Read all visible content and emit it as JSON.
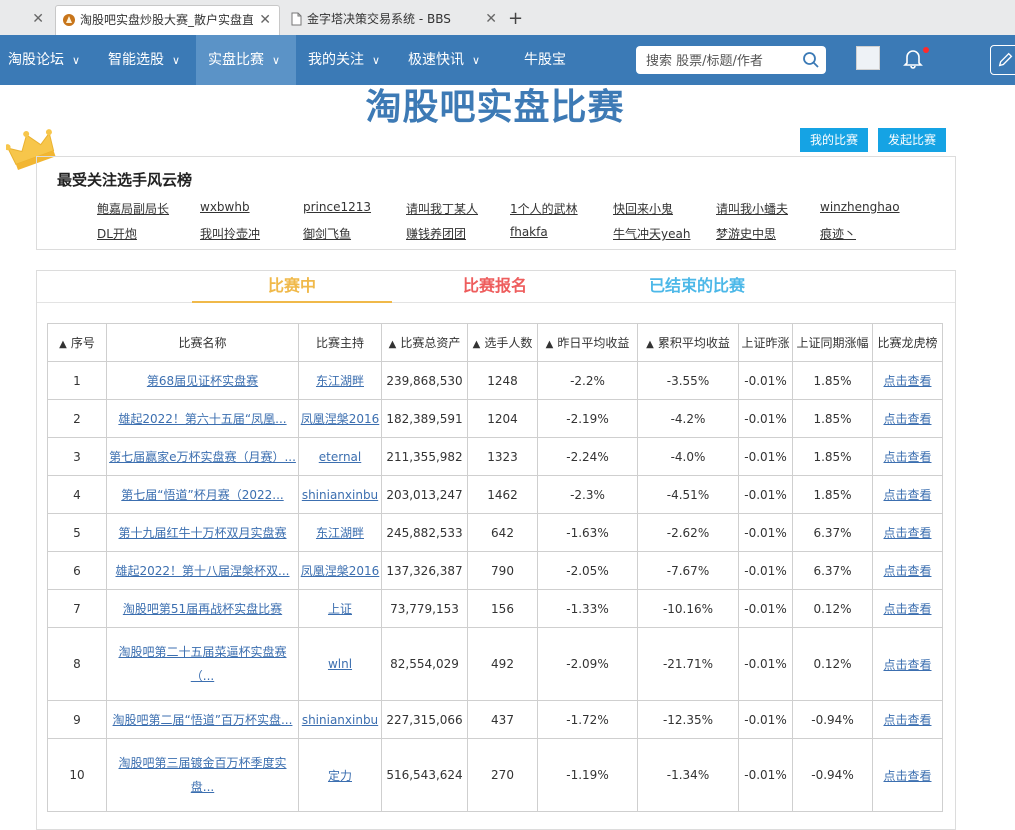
{
  "browser": {
    "tabs": [
      {
        "title": ""
      },
      {
        "title": "淘股吧实盘炒股大赛_散户实盘直"
      },
      {
        "title": "金字塔决策交易系统 - BBS"
      }
    ],
    "close_glyph": "✕",
    "new_tab_glyph": "+"
  },
  "nav": {
    "items": [
      {
        "label": "淘股论坛",
        "dropdown": true
      },
      {
        "label": "智能选股",
        "dropdown": true
      },
      {
        "label": "实盘比赛",
        "dropdown": true,
        "active": true
      },
      {
        "label": "我的关注",
        "dropdown": true
      },
      {
        "label": "极速快讯",
        "dropdown": true
      },
      {
        "label": "牛股宝",
        "dropdown": false
      }
    ],
    "chevron": "∨",
    "search_placeholder": "搜索 股票/标题/作者",
    "accent_color": "#3b7ab6"
  },
  "page": {
    "title": "淘股吧实盘比赛",
    "my_comp_button": "我的比赛",
    "start_comp_button": "发起比赛"
  },
  "fans": {
    "title": "最受关注选手风云榜",
    "users": [
      "鲍嘉局副局长",
      "wxbwhb",
      "prince1213",
      "请叫我丁某人",
      "1个人的武林",
      "快回来小鬼",
      "请叫我小蟠夫",
      "winzhenghao",
      "DL开炮",
      "我叫拎壶冲",
      "御剑飞鱼",
      "赚钱养团团",
      "fhakfa",
      "牛气冲天yeah",
      "梦游史中思",
      "痕迹丶"
    ]
  },
  "tabs": {
    "ongoing": "比赛中",
    "signup": "比赛报名",
    "ended": "已结束的比赛"
  },
  "table": {
    "sort_glyph": "▲",
    "headers": [
      "序号",
      "比赛名称",
      "比赛主持",
      "比赛总资产",
      "选手人数",
      "昨日平均收益",
      "累积平均收益",
      "上证昨涨",
      "上证同期涨幅",
      "比赛龙虎榜"
    ],
    "rows": [
      {
        "no": "1",
        "name": "第68届见证杯实盘赛",
        "host": "东江湖畔",
        "assets": "239,868,530",
        "players": "1248",
        "yday": "-2.2%",
        "cum": "-3.55%",
        "sh": "-0.01%",
        "sh_period": "1.85%",
        "link": "点击查看"
      },
      {
        "no": "2",
        "name": "雄起2022！第六十五届“凤凰...",
        "host": "凤凰涅槃2016",
        "assets": "182,389,591",
        "players": "1204",
        "yday": "-2.19%",
        "cum": "-4.2%",
        "sh": "-0.01%",
        "sh_period": "1.85%",
        "link": "点击查看"
      },
      {
        "no": "3",
        "name": "第七届赢家e万杯实盘赛（月赛）...",
        "host": "eternal",
        "assets": "211,355,982",
        "players": "1323",
        "yday": "-2.24%",
        "cum": "-4.0%",
        "sh": "-0.01%",
        "sh_period": "1.85%",
        "link": "点击查看"
      },
      {
        "no": "4",
        "name": "第七届“悟道”杯月赛（2022...",
        "host": "shinianxinbu",
        "assets": "203,013,247",
        "players": "1462",
        "yday": "-2.3%",
        "cum": "-4.51%",
        "sh": "-0.01%",
        "sh_period": "1.85%",
        "link": "点击查看"
      },
      {
        "no": "5",
        "name": "第十九届红牛十万杯双月实盘赛",
        "host": "东江湖畔",
        "assets": "245,882,533",
        "players": "642",
        "yday": "-1.63%",
        "cum": "-2.62%",
        "sh": "-0.01%",
        "sh_period": "6.37%",
        "link": "点击查看"
      },
      {
        "no": "6",
        "name": "雄起2022！第十八届涅槃杯双...",
        "host": "凤凰涅槃2016",
        "assets": "137,326,387",
        "players": "790",
        "yday": "-2.05%",
        "cum": "-7.67%",
        "sh": "-0.01%",
        "sh_period": "6.37%",
        "link": "点击查看"
      },
      {
        "no": "7",
        "name": "淘股吧第51届再战杯实盘比赛",
        "host": "上证",
        "assets": "73,779,153",
        "players": "156",
        "yday": "-1.33%",
        "cum": "-10.16%",
        "sh": "-0.01%",
        "sh_period": "0.12%",
        "link": "点击查看"
      },
      {
        "no": "8",
        "name": "淘股吧第二十五届菜逼杯实盘赛（...",
        "host": "wlnl",
        "assets": "82,554,029",
        "players": "492",
        "yday": "-2.09%",
        "cum": "-21.71%",
        "sh": "-0.01%",
        "sh_period": "0.12%",
        "link": "点击查看"
      },
      {
        "no": "9",
        "name": "淘股吧第二届“悟道”百万杯实盘...",
        "host": "shinianxinbu",
        "assets": "227,315,066",
        "players": "437",
        "yday": "-1.72%",
        "cum": "-12.35%",
        "sh": "-0.01%",
        "sh_period": "-0.94%",
        "link": "点击查看"
      },
      {
        "no": "10",
        "name": "淘股吧第三届镀金百万杯季度实盘...",
        "host": "定力",
        "assets": "516,543,624",
        "players": "270",
        "yday": "-1.19%",
        "cum": "-1.34%",
        "sh": "-0.01%",
        "sh_period": "-0.94%",
        "link": "点击查看"
      }
    ]
  }
}
